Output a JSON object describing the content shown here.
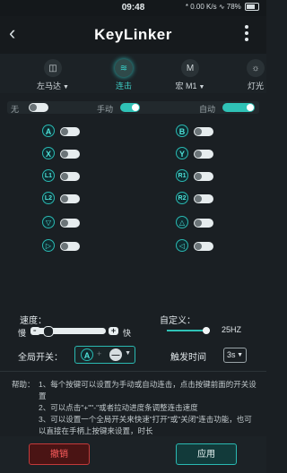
{
  "status": {
    "time": "09:48",
    "right": "* 0.00 K/s ∿ 78%"
  },
  "header": {
    "title": "KeyLinker"
  },
  "tabs": [
    {
      "label": "左马达",
      "icon": "motor-icon"
    },
    {
      "label": "连击",
      "icon": "turbo-icon"
    },
    {
      "label": "宏 M1",
      "icon": "macro-icon"
    },
    {
      "label": "灯光",
      "icon": "light-icon"
    }
  ],
  "mode": {
    "off": "无",
    "manual": "手动",
    "auto": "自动"
  },
  "buttons_left": [
    "A",
    "X",
    "L1",
    "L2",
    "▽",
    "▷"
  ],
  "buttons_right": [
    "B",
    "Y",
    "R1",
    "R2",
    "△",
    "◁"
  ],
  "speed": {
    "label": "速度：",
    "slow": "慢",
    "fast": "快",
    "level": 0.12
  },
  "custom": {
    "label": "自定义：",
    "value": "25HZ"
  },
  "global": {
    "label": "全局开关：",
    "key1": "A",
    "key2": "—"
  },
  "trigger": {
    "label": "触发时间",
    "value": "3s"
  },
  "help": {
    "title": "帮助：",
    "lines": [
      "1、每个按键可以设置为手动或自动连击，点击按键前面的开关设置",
      "2、可以点击\"+\"\"-\"或者拉动进度条调整连击速度",
      "3、可以设置一个全局开关来快速\"打开\"或\"关闭\"连击功能，也可以直接在手柄上按键来设置，时长"
    ]
  },
  "footer": {
    "cancel": "撤销",
    "apply": "应用"
  }
}
